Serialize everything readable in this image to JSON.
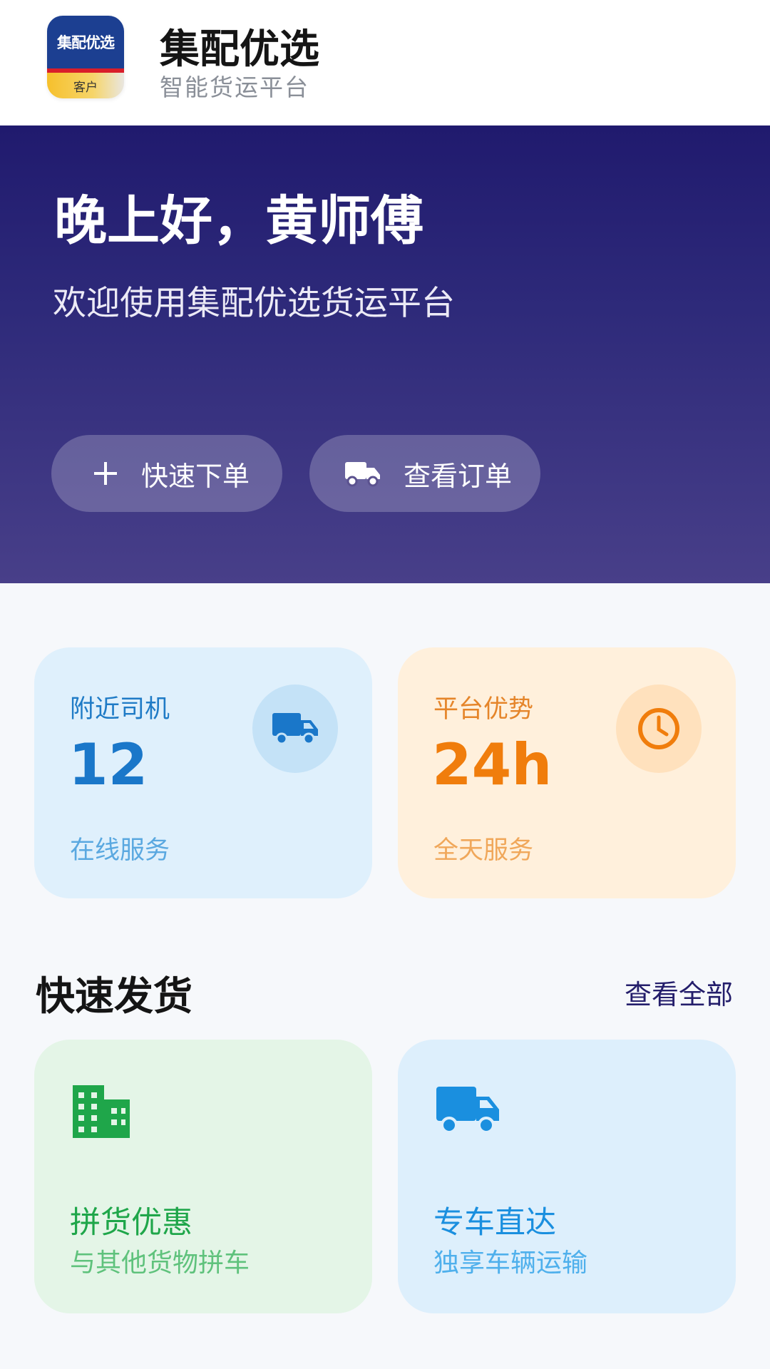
{
  "app": {
    "logo_text": "集配优选",
    "logo_tag": "客户",
    "title": "集配优选",
    "subtitle": "智能货运平台"
  },
  "hero": {
    "greeting": "晚上好，黄师傅",
    "welcome": "欢迎使用集配优选货运平台",
    "quick_order_label": "快速下单",
    "view_orders_label": "查看订单"
  },
  "stats": {
    "drivers": {
      "label": "附近司机",
      "value": "12",
      "note": "在线服务",
      "icon": "truck-icon"
    },
    "advantage": {
      "label": "平台优势",
      "value": "24h",
      "note": "全天服务",
      "icon": "clock-icon"
    }
  },
  "quick_ship": {
    "title": "快速发货",
    "see_all": "查看全部",
    "options": [
      {
        "title": "拼货优惠",
        "desc": "与其他货物拼车",
        "icon": "building-icon"
      },
      {
        "title": "专车直达",
        "desc": "独享车辆运输",
        "icon": "truck-icon"
      }
    ]
  },
  "colors": {
    "hero_top": "#201a6e",
    "hero_bottom": "#483f89",
    "blue_accent": "#1a77c9",
    "orange_accent": "#f07d0c",
    "green_accent": "#1fa64a"
  }
}
